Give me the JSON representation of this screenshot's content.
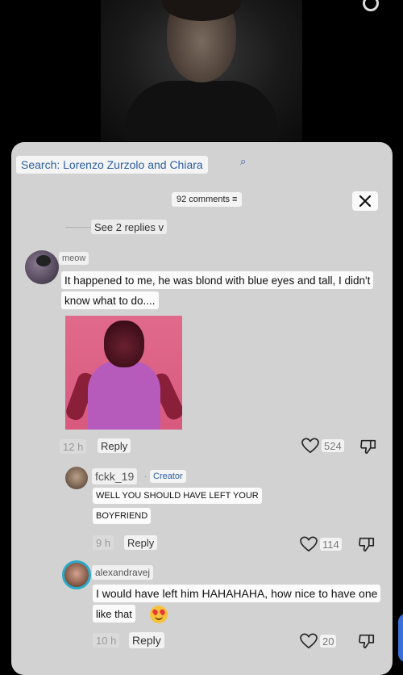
{
  "search": {
    "label": "Search: Lorenzo Zurzolo and Chiara",
    "icon": "search-icon"
  },
  "header": {
    "comment_count": "92 comments",
    "count_suffix": "≡",
    "close_icon": "close-icon"
  },
  "see_replies": "See 2 replies v",
  "comments": [
    {
      "username": "meow",
      "lines": [
        "It happened to me, he was blond with blue eyes and tall, I didn't",
        "know what to do...."
      ],
      "time": "12 h",
      "reply_label": "Reply",
      "likes": "524"
    },
    {
      "username": "fckk_19",
      "badge": "Creator",
      "separator": "·",
      "lines": [
        "WELL YOU SHOULD HAVE LEFT YOUR",
        "BOYFRIEND"
      ],
      "time": "9 h",
      "reply_label": "Reply",
      "likes": "114"
    },
    {
      "username": "alexandravej",
      "lines": [
        "I would have left him HAHAHAHA, how nice to have one",
        "like that"
      ],
      "emoji": "heart-eyes-emoji",
      "time": "10 h",
      "reply_label": "Reply",
      "likes": "20"
    }
  ],
  "colors": {
    "sheet": "#d2d2d2",
    "link_blue": "#2a5fa0",
    "avatar_ring": "#2aa9c9"
  }
}
